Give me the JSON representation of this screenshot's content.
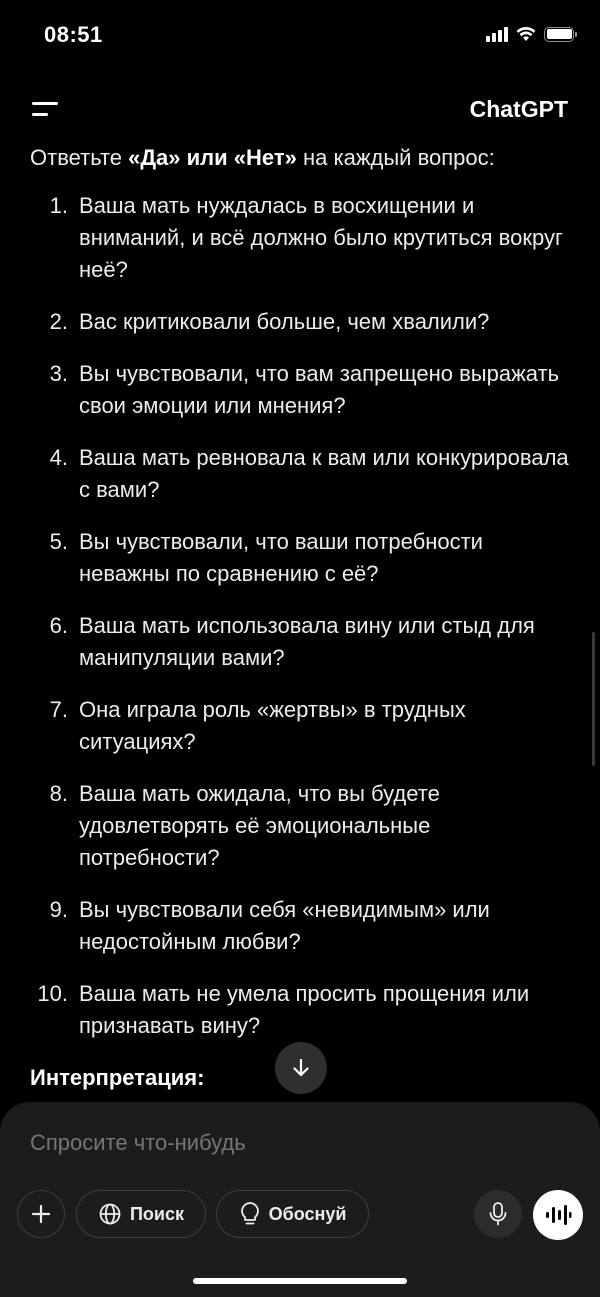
{
  "status_bar": {
    "time": "08:51"
  },
  "header": {
    "title": "ChatGPT"
  },
  "message": {
    "intro_prefix": "Ответьте ",
    "intro_bold": "«Да» или «Нет»",
    "intro_suffix": " на каждый вопрос:",
    "questions": [
      {
        "num": "1.",
        "text": "Ваша мать нуждалась в восхищении и вниманий, и всё должно было крутиться вокруг неё?"
      },
      {
        "num": "2.",
        "text": "Вас критиковали больше, чем хвалили?"
      },
      {
        "num": "3.",
        "text": "Вы чувствовали, что вам запрещено выражать свои эмоции или мнения?"
      },
      {
        "num": "4.",
        "text": "Ваша мать ревновала к вам или конкурировала с вами?"
      },
      {
        "num": "5.",
        "text": "Вы чувствовали, что ваши потребности неважны по сравнению с её?"
      },
      {
        "num": "6.",
        "text": "Ваша мать использовала вину или стыд для манипуляции вами?"
      },
      {
        "num": "7.",
        "text": "Она играла роль «жертвы» в трудных ситуациях?"
      },
      {
        "num": "8.",
        "text": "Ваша мать ожидала, что вы будете удовлетворять её эмоциональные потребности?"
      },
      {
        "num": "9.",
        "text": "Вы чувствовали себя «невидимым» или недостойным любви?"
      },
      {
        "num": "10.",
        "text": "Ваша мать не умела просить прощения или признавать вину?"
      }
    ],
    "next_heading": "Интерпретация:"
  },
  "composer": {
    "placeholder": "Спросите что-нибудь",
    "search_label": "Поиск",
    "reason_label": "Обоснуй"
  },
  "icons": {
    "menu": "menu-icon",
    "scroll_down": "arrow-down-icon",
    "plus": "plus-icon",
    "globe": "globe-icon",
    "bulb": "lightbulb-icon",
    "mic": "microphone-icon",
    "voice": "voice-waveform-icon"
  },
  "colors": {
    "background": "#000000",
    "composer": "#1c1c1c",
    "text": "#ececec",
    "placeholder": "#8a8a8a"
  }
}
